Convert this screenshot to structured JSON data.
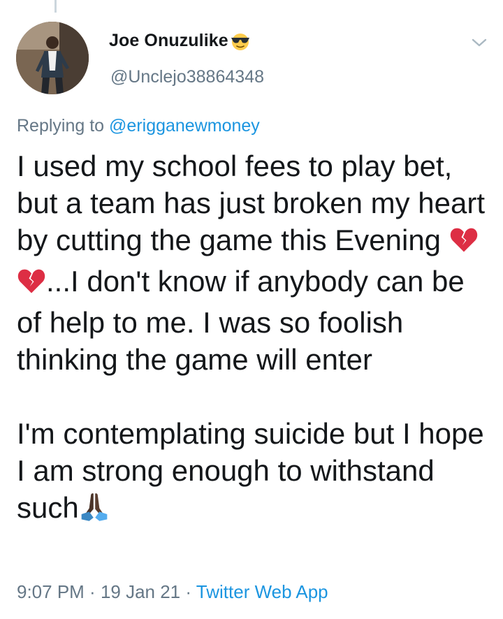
{
  "author": {
    "display_name": "Joe Onuzulike",
    "name_emoji": "sunglasses-emoji",
    "handle": "@Unclejo38864348"
  },
  "reply": {
    "prefix": "Replying to",
    "mention": "@erigganewmoney"
  },
  "tweet": {
    "line1": "I used my school fees to play bet, but a team has just broken my heart by cutting the game this Evening ",
    "line1_emojis": [
      "broken-heart-emoji",
      "broken-heart-emoji"
    ],
    "line2": "...I don't know if anybody can be of help to me. I was so foolish thinking the game will enter",
    "line3": "I'm contemplating suicide but I hope I am strong enough to withstand such",
    "line3_emoji": "folded-hands-emoji"
  },
  "meta": {
    "time": "9:07 PM",
    "separator": " · ",
    "date": "19 Jan 21",
    "source": "Twitter Web App"
  },
  "colors": {
    "text": "#14171a",
    "secondary": "#657786",
    "link": "#1b95e0",
    "broken_heart": "#dd2e44"
  }
}
